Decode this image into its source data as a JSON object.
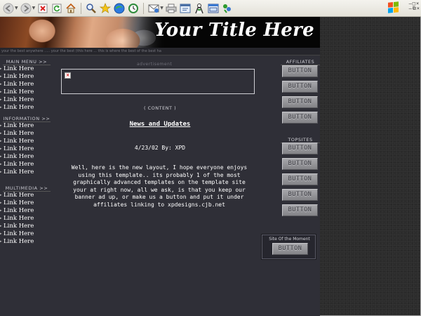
{
  "browser": {
    "toolbar_icons": [
      "back-icon",
      "forward-icon",
      "stop-icon",
      "refresh-icon",
      "home-icon",
      "search-icon",
      "favorites-icon",
      "media-icon",
      "history-icon",
      "mail-icon",
      "print-icon",
      "edit-icon",
      "messenger-icon",
      "research-icon",
      "msn-icon"
    ]
  },
  "site": {
    "title": "Your Title Here",
    "tagline": "your the best anywhere ..... your the best (this here ... this is where the best of the best ha"
  },
  "nav": {
    "main_menu": {
      "title": "MAIN MENU >>",
      "links": [
        "Link Here",
        "Link Here",
        "Link Here",
        "Link Here",
        "Link Here",
        "Link Here"
      ]
    },
    "information": {
      "title": "INFORMATION >>",
      "links": [
        "Link Here",
        "Link Here",
        "Link Here",
        "Link Here",
        "Link Here",
        "Link Here",
        "Link Here"
      ]
    },
    "multimedia": {
      "title": "MULTIMEDIA >>",
      "links": [
        "Link Here",
        "Link Here",
        "Link Here",
        "Link Here",
        "Link Here",
        "Link Here",
        "Link Here"
      ]
    }
  },
  "ad": {
    "label": "advertisement"
  },
  "content": {
    "label": "( CONTENT )",
    "news_title": "News and Updates",
    "date": "4/23/02 By: XPD",
    "body": "Well, here is the new layout, I hope everyone enjoys using this template.. its probably 1 of the most graphically advanced templates on the template site your at right now, all we ask, is that you keep our banner ad up, or make us a button and put it under affiliates linking to xpdesigns.cjb.net"
  },
  "affiliates": {
    "title": "AFFILIATES",
    "buttons": [
      "BUTTON",
      "BUTTON",
      "BUTTON",
      "BUTTON"
    ]
  },
  "topsites": {
    "title": "TOPSITES",
    "buttons": [
      "BUTTON",
      "BUTTON",
      "BUTTON",
      "BUTTON",
      "BUTTON"
    ]
  },
  "site_of_moment": {
    "title": "Site Of the Moment",
    "button": "BUTTON"
  },
  "colors": {
    "page_background": "#2f2f37",
    "outer_background": "#2c2c2c",
    "text": "#ffffff",
    "button_face": "#9a9a9e"
  }
}
